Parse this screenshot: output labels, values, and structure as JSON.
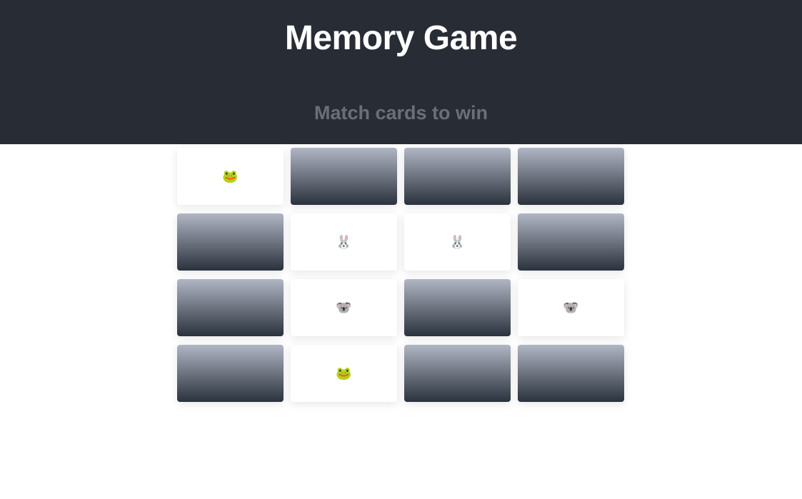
{
  "header": {
    "title": "Memory Game",
    "subtitle": "Match cards to win"
  },
  "colors": {
    "header_bg": "#282c34",
    "subtitle": "#6b6f76",
    "card_back_top": "#b0b6c3",
    "card_back_bottom": "#2a323d"
  },
  "board": {
    "cards": [
      {
        "state": "face-up",
        "emoji": "🐸",
        "icon": "frog-icon"
      },
      {
        "state": "face-down",
        "emoji": "",
        "icon": ""
      },
      {
        "state": "face-down",
        "emoji": "",
        "icon": ""
      },
      {
        "state": "face-down",
        "emoji": "",
        "icon": ""
      },
      {
        "state": "face-down",
        "emoji": "",
        "icon": ""
      },
      {
        "state": "face-up",
        "emoji": "🐰",
        "icon": "rabbit-icon"
      },
      {
        "state": "face-up",
        "emoji": "🐰",
        "icon": "rabbit-icon"
      },
      {
        "state": "face-down",
        "emoji": "",
        "icon": ""
      },
      {
        "state": "face-down",
        "emoji": "",
        "icon": ""
      },
      {
        "state": "face-up",
        "emoji": "🐨",
        "icon": "koala-icon"
      },
      {
        "state": "face-down",
        "emoji": "",
        "icon": ""
      },
      {
        "state": "face-up",
        "emoji": "🐨",
        "icon": "koala-icon"
      },
      {
        "state": "face-down",
        "emoji": "",
        "icon": ""
      },
      {
        "state": "face-up",
        "emoji": "🐸",
        "icon": "frog-icon"
      },
      {
        "state": "face-down",
        "emoji": "",
        "icon": ""
      },
      {
        "state": "face-down",
        "emoji": "",
        "icon": ""
      }
    ]
  }
}
